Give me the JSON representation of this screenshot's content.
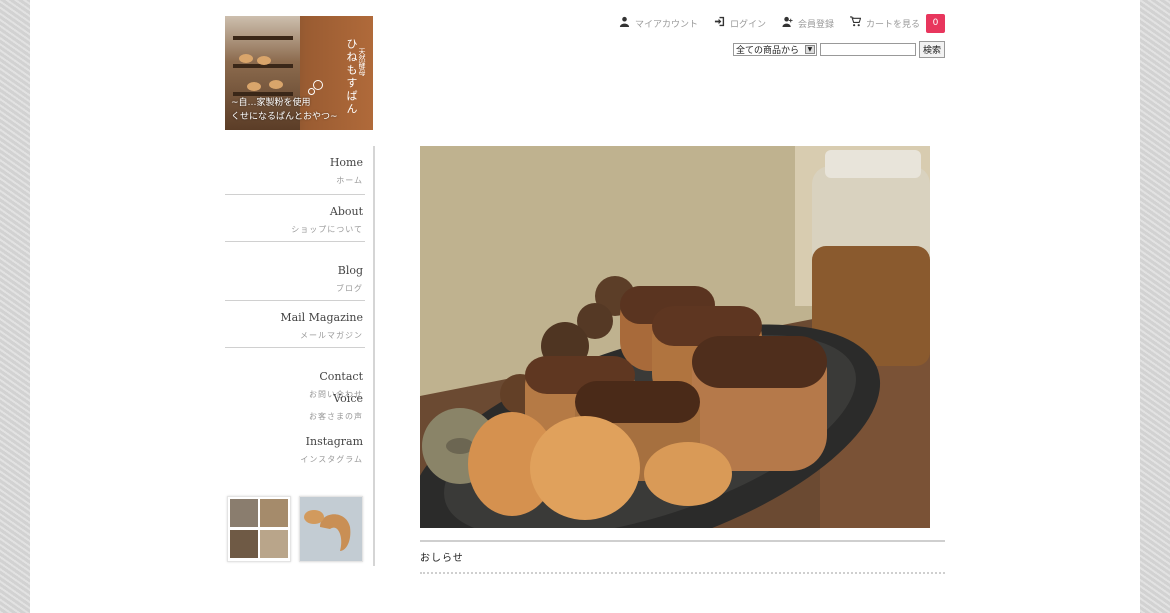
{
  "logo": {
    "vertical_title": "ひねもすぱん",
    "vertical_small": "天然酵母",
    "tagline_1": "~自…家製粉を使用",
    "tagline_2": "くせになるぱんとおやつ~"
  },
  "topnav": {
    "my_account": "マイアカウント",
    "login": "ログイン",
    "register": "会員登録",
    "cart": "カートを見る",
    "cart_count": "0"
  },
  "search": {
    "category_selected": "全ての商品から",
    "input_value": "",
    "button_label": "検索"
  },
  "sidebar": {
    "items": [
      {
        "en": "Home",
        "jp": "ホーム"
      },
      {
        "en": "About",
        "jp": "ショップについて"
      },
      {
        "en": "Blog",
        "jp": "ブログ"
      },
      {
        "en": "Mail Magazine",
        "jp": "メールマガジン"
      },
      {
        "en": "Contact",
        "jp": "お問い合わせ"
      },
      {
        "en": "Voice",
        "jp": "お客さまの声"
      },
      {
        "en": "Instagram",
        "jp": "インスタグラム"
      }
    ]
  },
  "main": {
    "notice_title": "おしらせ"
  },
  "colors": {
    "cart_badge": "#e8365d",
    "page_bg": "#ffffff",
    "outer_bg": "#d9d9d9"
  }
}
